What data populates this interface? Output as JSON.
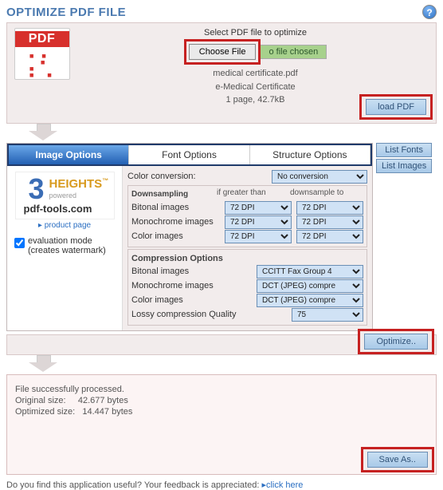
{
  "title": "OPTIMIZE PDF FILE",
  "upload": {
    "prompt": "Select PDF file to optimize",
    "choose_btn": "Choose File",
    "file_status": "o file chosen",
    "filename": "medical certificate.pdf",
    "subtitle": "e-Medical Certificate",
    "pages_size": "1 page, 42.7kB",
    "load_btn": "load PDF"
  },
  "tabs": {
    "image": "Image Options",
    "font": "Font Options",
    "structure": "Structure Options"
  },
  "side": {
    "list_fonts": "List Fonts",
    "list_images": "List Images"
  },
  "left_panel": {
    "product_link": "▸ product page",
    "eval_label": "evaluation mode (creates watermark)"
  },
  "opts": {
    "color_conv_label": "Color conversion:",
    "color_conv_value": "No conversion",
    "downsampling_label": "Downsampling",
    "col_if_greater": "if greater than",
    "col_downsample_to": "downsample to",
    "bitonal_label": "Bitonal images",
    "mono_label": "Monochrome images",
    "color_label": "Color images",
    "dpi72": "72 DPI",
    "compression_label": "Compression Options",
    "lossy_label": "Lossy compression Quality",
    "comp_bitonal": "CCITT Fax Group 4",
    "comp_mono": "DCT (JPEG) compre",
    "comp_color": "DCT (JPEG) compre",
    "lossy_val": "75"
  },
  "optimize_btn": "Optimize..",
  "status": {
    "processed": "File successfully processed.",
    "orig_label": "Original size:",
    "orig_val": "42.677 bytes",
    "opt_label": "Optimized size:",
    "opt_val": "14.447 bytes"
  },
  "save_btn": "Save As..",
  "feedback": {
    "text": "Do you find this application useful? Your feedback is appreciated: ",
    "link": "▸click here"
  }
}
